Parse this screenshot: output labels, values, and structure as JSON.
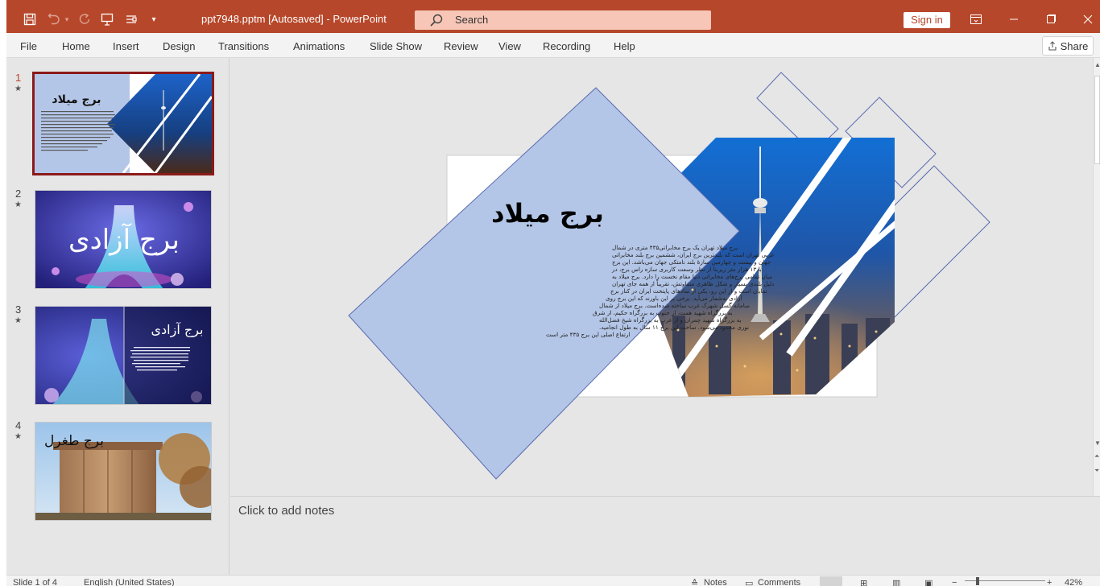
{
  "window": {
    "title": "ppt7948.pptm [Autosaved]  -  PowerPoint",
    "search_placeholder": "Search",
    "sign_in": "Sign in"
  },
  "menu": {
    "items": [
      "File",
      "Home",
      "Insert",
      "Design",
      "Transitions",
      "Animations",
      "Slide Show",
      "Review",
      "View",
      "Recording",
      "Help"
    ],
    "share": "Share"
  },
  "thumbnails": [
    {
      "number": "1",
      "title": "برج میلاد",
      "active": true
    },
    {
      "number": "2",
      "title": "برج آزادی",
      "active": false
    },
    {
      "number": "3",
      "title": "برج آزادی",
      "active": false
    },
    {
      "number": "4",
      "title": "برج طغرل",
      "active": false
    }
  ],
  "slide": {
    "title": "برج میلاد",
    "body_lines": [
      "برج میلاد تهران یک برج مخابراتی۴۳۵ متری در شمال",
      "غربی تهران است که بلندترین برج ایران، ششمین برج بلند مخابراتی",
      "جهان و بیست و چهارمین سازهٔ بلند نامتکی جهان می‌باشد. این برج",
      "با ۱۳ هزار متر زیربنا از نظر وسعت کاربری سازه راس برج، در",
      "میان تمامی برج‌های مخابراتی دنیا مقام نخست را دارد. برج میلاد به",
      "دلیل بلندی بسیار و شکل ظاهری متفاوتش، تقریباً از همه جای تهران",
      "نمایان است و از این رو، یکی از نمادهای پایتخت ایران در کنار برج",
      "آزادی به‌شمار می‌آید. برخی بر این باورند که این برج روی",
      "سامانه گسل شهرک غرب ساخته شده‌است. برج میلاد از شمال",
      "به بزرگراه شهید همت، از جنوب به بزرگراه حکیم، از شرق",
      "به بزرگراه شهید چمران و از غرب به بزرگراه شیخ فضل‌الله",
      "نوری محدود می‌شود. ساخت این برج ۱۱ سال به طول انجامید.",
      "ارتفاع اصلی این برج ۴۳۵ متر است"
    ]
  },
  "notes_placeholder": "Click to add notes",
  "status": {
    "slide_of": "Slide 1 of 4",
    "language": "English (United States)",
    "notes": "Notes",
    "comments": "Comments",
    "zoom": "42%"
  },
  "colors": {
    "titlebar": "#b7472a",
    "search_bg": "#f7c6b6",
    "app_bg": "#e6e6e6",
    "slide_diamond": "#b4c6e7",
    "active_thumb_border": "#8b1a1a"
  }
}
